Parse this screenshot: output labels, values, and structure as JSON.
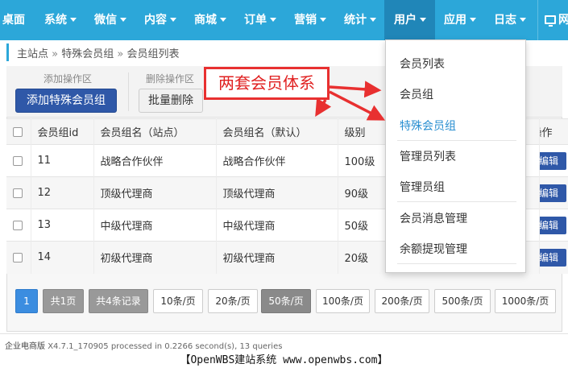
{
  "nav": {
    "items": [
      {
        "label": "桌面",
        "caret": false
      },
      {
        "label": "系统",
        "caret": true
      },
      {
        "label": "微信",
        "caret": true
      },
      {
        "label": "内容",
        "caret": true
      },
      {
        "label": "商城",
        "caret": true
      },
      {
        "label": "订单",
        "caret": true
      },
      {
        "label": "营销",
        "caret": true
      },
      {
        "label": "统计",
        "caret": true
      },
      {
        "label": "用户",
        "caret": true,
        "active": true
      },
      {
        "label": "应用",
        "caret": true
      },
      {
        "label": "日志",
        "caret": true
      },
      {
        "label": "网",
        "caret": false,
        "icon": "monitor-icon"
      }
    ]
  },
  "breadcrumb": {
    "home": "主站点",
    "sep": "»",
    "level1": "特殊会员组",
    "level2": "会员组列表"
  },
  "toolbar": {
    "add_group_label": "添加操作区",
    "add_button": "添加特殊会员组",
    "delete_group_label": "删除操作区",
    "delete_button": "批量删除"
  },
  "table": {
    "headers": [
      "会员组id",
      "会员组名（站点）",
      "会员组名（默认）",
      "级别",
      "操作"
    ],
    "rows": [
      {
        "id": "11",
        "site_name": "战略合作伙伴",
        "default_name": "战略合作伙伴",
        "level": "100级",
        "action": "编辑"
      },
      {
        "id": "12",
        "site_name": "顶级代理商",
        "default_name": "顶级代理商",
        "level": "90级",
        "action": "编辑"
      },
      {
        "id": "13",
        "site_name": "中级代理商",
        "default_name": "中级代理商",
        "level": "50级",
        "action": "编辑"
      },
      {
        "id": "14",
        "site_name": "初级代理商",
        "default_name": "初级代理商",
        "level": "20级",
        "action": "编辑"
      }
    ]
  },
  "pagination": {
    "current": "1",
    "total_pages": "共1页",
    "total_records": "共4条记录",
    "sizes": [
      "10条/页",
      "20条/页",
      "50条/页",
      "100条/页",
      "200条/页",
      "500条/页",
      "1000条/页"
    ],
    "selected_size": "50条/页"
  },
  "dropdown": {
    "items": [
      "会员列表",
      "会员组",
      "特殊会员组",
      "管理员列表",
      "管理员组",
      "会员消息管理",
      "余额提现管理"
    ],
    "highlighted": "特殊会员组"
  },
  "annotation": {
    "text": "两套会员体系"
  },
  "footer": {
    "edition": "企业电商版",
    "info": "X4.7.1_170905 processed in 0.2266 second(s), 13 queries"
  },
  "caption": "【OpenWBS建站系统 www.openwbs.com】",
  "colors": {
    "nav": "#2ca7d9",
    "primary_button": "#2f58a8",
    "annotation": "#e83030",
    "highlight": "#2a8fd1"
  }
}
